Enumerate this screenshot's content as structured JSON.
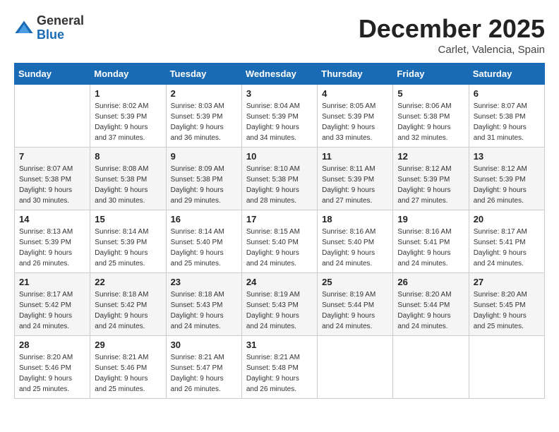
{
  "header": {
    "logo_general": "General",
    "logo_blue": "Blue",
    "month_title": "December 2025",
    "location": "Carlet, Valencia, Spain"
  },
  "weekdays": [
    "Sunday",
    "Monday",
    "Tuesday",
    "Wednesday",
    "Thursday",
    "Friday",
    "Saturday"
  ],
  "weeks": [
    [
      {
        "day": "",
        "sunrise": "",
        "sunset": "",
        "daylight": ""
      },
      {
        "day": "1",
        "sunrise": "Sunrise: 8:02 AM",
        "sunset": "Sunset: 5:39 PM",
        "daylight": "Daylight: 9 hours and 37 minutes."
      },
      {
        "day": "2",
        "sunrise": "Sunrise: 8:03 AM",
        "sunset": "Sunset: 5:39 PM",
        "daylight": "Daylight: 9 hours and 36 minutes."
      },
      {
        "day": "3",
        "sunrise": "Sunrise: 8:04 AM",
        "sunset": "Sunset: 5:39 PM",
        "daylight": "Daylight: 9 hours and 34 minutes."
      },
      {
        "day": "4",
        "sunrise": "Sunrise: 8:05 AM",
        "sunset": "Sunset: 5:39 PM",
        "daylight": "Daylight: 9 hours and 33 minutes."
      },
      {
        "day": "5",
        "sunrise": "Sunrise: 8:06 AM",
        "sunset": "Sunset: 5:38 PM",
        "daylight": "Daylight: 9 hours and 32 minutes."
      },
      {
        "day": "6",
        "sunrise": "Sunrise: 8:07 AM",
        "sunset": "Sunset: 5:38 PM",
        "daylight": "Daylight: 9 hours and 31 minutes."
      }
    ],
    [
      {
        "day": "7",
        "sunrise": "Sunrise: 8:07 AM",
        "sunset": "Sunset: 5:38 PM",
        "daylight": "Daylight: 9 hours and 30 minutes."
      },
      {
        "day": "8",
        "sunrise": "Sunrise: 8:08 AM",
        "sunset": "Sunset: 5:38 PM",
        "daylight": "Daylight: 9 hours and 30 minutes."
      },
      {
        "day": "9",
        "sunrise": "Sunrise: 8:09 AM",
        "sunset": "Sunset: 5:38 PM",
        "daylight": "Daylight: 9 hours and 29 minutes."
      },
      {
        "day": "10",
        "sunrise": "Sunrise: 8:10 AM",
        "sunset": "Sunset: 5:38 PM",
        "daylight": "Daylight: 9 hours and 28 minutes."
      },
      {
        "day": "11",
        "sunrise": "Sunrise: 8:11 AM",
        "sunset": "Sunset: 5:39 PM",
        "daylight": "Daylight: 9 hours and 27 minutes."
      },
      {
        "day": "12",
        "sunrise": "Sunrise: 8:12 AM",
        "sunset": "Sunset: 5:39 PM",
        "daylight": "Daylight: 9 hours and 27 minutes."
      },
      {
        "day": "13",
        "sunrise": "Sunrise: 8:12 AM",
        "sunset": "Sunset: 5:39 PM",
        "daylight": "Daylight: 9 hours and 26 minutes."
      }
    ],
    [
      {
        "day": "14",
        "sunrise": "Sunrise: 8:13 AM",
        "sunset": "Sunset: 5:39 PM",
        "daylight": "Daylight: 9 hours and 26 minutes."
      },
      {
        "day": "15",
        "sunrise": "Sunrise: 8:14 AM",
        "sunset": "Sunset: 5:39 PM",
        "daylight": "Daylight: 9 hours and 25 minutes."
      },
      {
        "day": "16",
        "sunrise": "Sunrise: 8:14 AM",
        "sunset": "Sunset: 5:40 PM",
        "daylight": "Daylight: 9 hours and 25 minutes."
      },
      {
        "day": "17",
        "sunrise": "Sunrise: 8:15 AM",
        "sunset": "Sunset: 5:40 PM",
        "daylight": "Daylight: 9 hours and 24 minutes."
      },
      {
        "day": "18",
        "sunrise": "Sunrise: 8:16 AM",
        "sunset": "Sunset: 5:40 PM",
        "daylight": "Daylight: 9 hours and 24 minutes."
      },
      {
        "day": "19",
        "sunrise": "Sunrise: 8:16 AM",
        "sunset": "Sunset: 5:41 PM",
        "daylight": "Daylight: 9 hours and 24 minutes."
      },
      {
        "day": "20",
        "sunrise": "Sunrise: 8:17 AM",
        "sunset": "Sunset: 5:41 PM",
        "daylight": "Daylight: 9 hours and 24 minutes."
      }
    ],
    [
      {
        "day": "21",
        "sunrise": "Sunrise: 8:17 AM",
        "sunset": "Sunset: 5:42 PM",
        "daylight": "Daylight: 9 hours and 24 minutes."
      },
      {
        "day": "22",
        "sunrise": "Sunrise: 8:18 AM",
        "sunset": "Sunset: 5:42 PM",
        "daylight": "Daylight: 9 hours and 24 minutes."
      },
      {
        "day": "23",
        "sunrise": "Sunrise: 8:18 AM",
        "sunset": "Sunset: 5:43 PM",
        "daylight": "Daylight: 9 hours and 24 minutes."
      },
      {
        "day": "24",
        "sunrise": "Sunrise: 8:19 AM",
        "sunset": "Sunset: 5:43 PM",
        "daylight": "Daylight: 9 hours and 24 minutes."
      },
      {
        "day": "25",
        "sunrise": "Sunrise: 8:19 AM",
        "sunset": "Sunset: 5:44 PM",
        "daylight": "Daylight: 9 hours and 24 minutes."
      },
      {
        "day": "26",
        "sunrise": "Sunrise: 8:20 AM",
        "sunset": "Sunset: 5:44 PM",
        "daylight": "Daylight: 9 hours and 24 minutes."
      },
      {
        "day": "27",
        "sunrise": "Sunrise: 8:20 AM",
        "sunset": "Sunset: 5:45 PM",
        "daylight": "Daylight: 9 hours and 25 minutes."
      }
    ],
    [
      {
        "day": "28",
        "sunrise": "Sunrise: 8:20 AM",
        "sunset": "Sunset: 5:46 PM",
        "daylight": "Daylight: 9 hours and 25 minutes."
      },
      {
        "day": "29",
        "sunrise": "Sunrise: 8:21 AM",
        "sunset": "Sunset: 5:46 PM",
        "daylight": "Daylight: 9 hours and 25 minutes."
      },
      {
        "day": "30",
        "sunrise": "Sunrise: 8:21 AM",
        "sunset": "Sunset: 5:47 PM",
        "daylight": "Daylight: 9 hours and 26 minutes."
      },
      {
        "day": "31",
        "sunrise": "Sunrise: 8:21 AM",
        "sunset": "Sunset: 5:48 PM",
        "daylight": "Daylight: 9 hours and 26 minutes."
      },
      {
        "day": "",
        "sunrise": "",
        "sunset": "",
        "daylight": ""
      },
      {
        "day": "",
        "sunrise": "",
        "sunset": "",
        "daylight": ""
      },
      {
        "day": "",
        "sunrise": "",
        "sunset": "",
        "daylight": ""
      }
    ]
  ]
}
